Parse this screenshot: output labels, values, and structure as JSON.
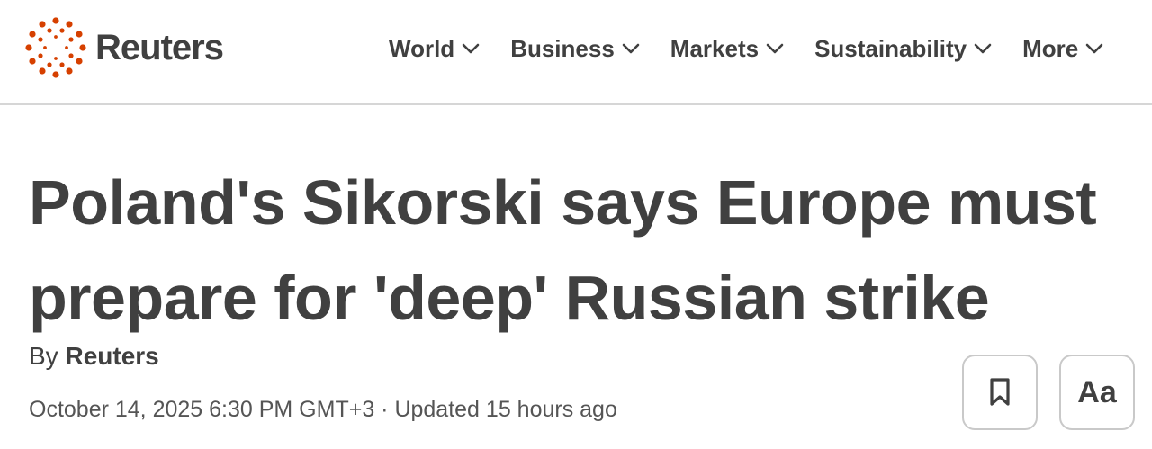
{
  "header": {
    "logo_text": "Reuters",
    "brand_color": "#d64000",
    "nav": [
      {
        "label": "World"
      },
      {
        "label": "Business"
      },
      {
        "label": "Markets"
      },
      {
        "label": "Sustainability"
      },
      {
        "label": "More"
      }
    ]
  },
  "article": {
    "headline_line1": "Poland's Sikorski says Europe must",
    "headline_line2": "prepare for 'deep' Russian strike",
    "by_prefix": "By",
    "author": "Reuters",
    "dateline": "October 14, 2025 6:30 PM GMT+3 · Updated 15 hours ago"
  },
  "tools": {
    "bookmark_icon": "bookmark-icon",
    "text_size_label": "Aa"
  }
}
